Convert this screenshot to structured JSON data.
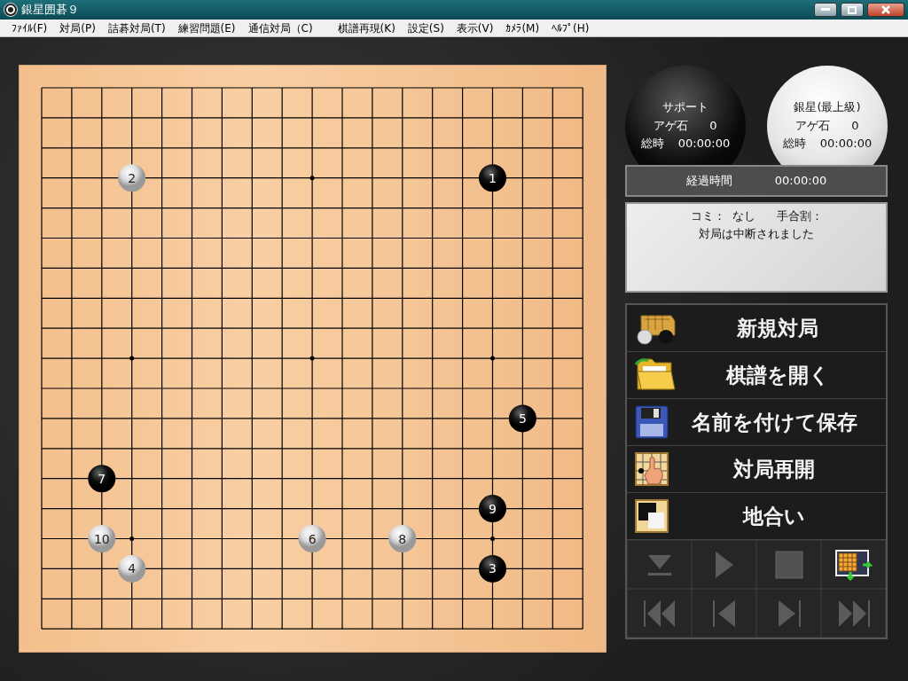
{
  "window": {
    "title": "銀星囲碁９"
  },
  "menu": [
    "ﾌｧｲﾙ(F)",
    "対局(P)",
    "詰碁対局(T)",
    "練習問題(E)",
    "通信対局（C)",
    "棋譜再現(K)",
    "設定(S)",
    "表示(V)",
    "ｶﾒﾗ(M)",
    "ﾍﾙﾌﾟ(H)"
  ],
  "board": {
    "rows": [
      [
        {
          "kind": "empty"
        },
        {
          "kind": "empty"
        },
        {
          "kind": "empty"
        },
        {
          "kind": "empty"
        },
        {
          "kind": "empty"
        },
        {
          "kind": "empty"
        },
        {
          "kind": "empty"
        },
        {
          "kind": "empty"
        },
        {
          "kind": "empty"
        },
        {
          "kind": "empty"
        },
        {
          "kind": "empty"
        },
        {
          "kind": "empty"
        },
        {
          "kind": "empty"
        },
        {
          "kind": "empty"
        },
        {
          "kind": "empty"
        },
        {
          "kind": "empty"
        },
        {
          "kind": "empty"
        },
        {
          "kind": "empty"
        },
        {
          "kind": "empty"
        }
      ],
      [
        {
          "kind": "empty"
        },
        {
          "kind": "empty"
        },
        {
          "kind": "empty"
        },
        {
          "kind": "empty"
        },
        {
          "kind": "empty"
        },
        {
          "kind": "empty"
        },
        {
          "kind": "empty"
        },
        {
          "kind": "empty"
        },
        {
          "kind": "empty"
        },
        {
          "kind": "empty"
        },
        {
          "kind": "empty"
        },
        {
          "kind": "empty"
        },
        {
          "kind": "empty"
        },
        {
          "kind": "empty"
        },
        {
          "kind": "empty"
        },
        {
          "kind": "empty"
        },
        {
          "kind": "empty"
        },
        {
          "kind": "empty"
        },
        {
          "kind": "empty"
        }
      ],
      [
        {
          "kind": "empty"
        },
        {
          "kind": "empty"
        },
        {
          "kind": "empty"
        },
        {
          "kind": "empty"
        },
        {
          "kind": "empty"
        },
        {
          "kind": "empty"
        },
        {
          "kind": "empty"
        },
        {
          "kind": "empty"
        },
        {
          "kind": "empty"
        },
        {
          "kind": "empty"
        },
        {
          "kind": "empty"
        },
        {
          "kind": "empty"
        },
        {
          "kind": "empty"
        },
        {
          "kind": "empty"
        },
        {
          "kind": "empty"
        },
        {
          "kind": "empty"
        },
        {
          "kind": "empty"
        },
        {
          "kind": "empty"
        },
        {
          "kind": "empty"
        }
      ],
      [
        {
          "kind": "empty"
        },
        {
          "kind": "empty"
        },
        {
          "kind": "empty"
        },
        {
          "kind": "white",
          "move": "2"
        },
        {
          "kind": "empty"
        },
        {
          "kind": "empty"
        },
        {
          "kind": "empty"
        },
        {
          "kind": "empty"
        },
        {
          "kind": "empty"
        },
        {
          "kind": "empty"
        },
        {
          "kind": "empty"
        },
        {
          "kind": "empty"
        },
        {
          "kind": "empty"
        },
        {
          "kind": "empty"
        },
        {
          "kind": "empty"
        },
        {
          "kind": "black",
          "move": "1"
        },
        {
          "kind": "empty"
        },
        {
          "kind": "empty"
        },
        {
          "kind": "empty"
        }
      ],
      [
        {
          "kind": "empty"
        },
        {
          "kind": "empty"
        },
        {
          "kind": "empty"
        },
        {
          "kind": "empty"
        },
        {
          "kind": "empty"
        },
        {
          "kind": "empty"
        },
        {
          "kind": "empty"
        },
        {
          "kind": "empty"
        },
        {
          "kind": "empty"
        },
        {
          "kind": "empty"
        },
        {
          "kind": "empty"
        },
        {
          "kind": "empty"
        },
        {
          "kind": "empty"
        },
        {
          "kind": "empty"
        },
        {
          "kind": "empty"
        },
        {
          "kind": "empty"
        },
        {
          "kind": "empty"
        },
        {
          "kind": "empty"
        },
        {
          "kind": "empty"
        }
      ],
      [
        {
          "kind": "empty"
        },
        {
          "kind": "empty"
        },
        {
          "kind": "empty"
        },
        {
          "kind": "empty"
        },
        {
          "kind": "empty"
        },
        {
          "kind": "empty"
        },
        {
          "kind": "empty"
        },
        {
          "kind": "empty"
        },
        {
          "kind": "empty"
        },
        {
          "kind": "empty"
        },
        {
          "kind": "empty"
        },
        {
          "kind": "empty"
        },
        {
          "kind": "empty"
        },
        {
          "kind": "empty"
        },
        {
          "kind": "empty"
        },
        {
          "kind": "empty"
        },
        {
          "kind": "empty"
        },
        {
          "kind": "empty"
        },
        {
          "kind": "empty"
        }
      ],
      [
        {
          "kind": "empty"
        },
        {
          "kind": "empty"
        },
        {
          "kind": "empty"
        },
        {
          "kind": "empty"
        },
        {
          "kind": "empty"
        },
        {
          "kind": "empty"
        },
        {
          "kind": "empty"
        },
        {
          "kind": "empty"
        },
        {
          "kind": "empty"
        },
        {
          "kind": "empty"
        },
        {
          "kind": "empty"
        },
        {
          "kind": "empty"
        },
        {
          "kind": "empty"
        },
        {
          "kind": "empty"
        },
        {
          "kind": "empty"
        },
        {
          "kind": "empty"
        },
        {
          "kind": "empty"
        },
        {
          "kind": "empty"
        },
        {
          "kind": "empty"
        }
      ],
      [
        {
          "kind": "empty"
        },
        {
          "kind": "empty"
        },
        {
          "kind": "empty"
        },
        {
          "kind": "empty"
        },
        {
          "kind": "empty"
        },
        {
          "kind": "empty"
        },
        {
          "kind": "empty"
        },
        {
          "kind": "empty"
        },
        {
          "kind": "empty"
        },
        {
          "kind": "empty"
        },
        {
          "kind": "empty"
        },
        {
          "kind": "empty"
        },
        {
          "kind": "empty"
        },
        {
          "kind": "empty"
        },
        {
          "kind": "empty"
        },
        {
          "kind": "empty"
        },
        {
          "kind": "empty"
        },
        {
          "kind": "empty"
        },
        {
          "kind": "empty"
        }
      ],
      [
        {
          "kind": "empty"
        },
        {
          "kind": "empty"
        },
        {
          "kind": "empty"
        },
        {
          "kind": "empty"
        },
        {
          "kind": "empty"
        },
        {
          "kind": "empty"
        },
        {
          "kind": "empty"
        },
        {
          "kind": "empty"
        },
        {
          "kind": "empty"
        },
        {
          "kind": "empty"
        },
        {
          "kind": "empty"
        },
        {
          "kind": "empty"
        },
        {
          "kind": "empty"
        },
        {
          "kind": "empty"
        },
        {
          "kind": "empty"
        },
        {
          "kind": "empty"
        },
        {
          "kind": "empty"
        },
        {
          "kind": "empty"
        },
        {
          "kind": "empty"
        }
      ],
      [
        {
          "kind": "empty"
        },
        {
          "kind": "empty"
        },
        {
          "kind": "empty"
        },
        {
          "kind": "empty"
        },
        {
          "kind": "empty"
        },
        {
          "kind": "empty"
        },
        {
          "kind": "empty"
        },
        {
          "kind": "empty"
        },
        {
          "kind": "empty"
        },
        {
          "kind": "empty"
        },
        {
          "kind": "empty"
        },
        {
          "kind": "empty"
        },
        {
          "kind": "empty"
        },
        {
          "kind": "empty"
        },
        {
          "kind": "empty"
        },
        {
          "kind": "empty"
        },
        {
          "kind": "empty"
        },
        {
          "kind": "empty"
        },
        {
          "kind": "empty"
        }
      ],
      [
        {
          "kind": "empty"
        },
        {
          "kind": "empty"
        },
        {
          "kind": "empty"
        },
        {
          "kind": "empty"
        },
        {
          "kind": "empty"
        },
        {
          "kind": "empty"
        },
        {
          "kind": "empty"
        },
        {
          "kind": "empty"
        },
        {
          "kind": "empty"
        },
        {
          "kind": "empty"
        },
        {
          "kind": "empty"
        },
        {
          "kind": "empty"
        },
        {
          "kind": "empty"
        },
        {
          "kind": "empty"
        },
        {
          "kind": "empty"
        },
        {
          "kind": "empty"
        },
        {
          "kind": "empty"
        },
        {
          "kind": "empty"
        },
        {
          "kind": "empty"
        }
      ],
      [
        {
          "kind": "empty"
        },
        {
          "kind": "empty"
        },
        {
          "kind": "empty"
        },
        {
          "kind": "empty"
        },
        {
          "kind": "empty"
        },
        {
          "kind": "empty"
        },
        {
          "kind": "empty"
        },
        {
          "kind": "empty"
        },
        {
          "kind": "empty"
        },
        {
          "kind": "empty"
        },
        {
          "kind": "empty"
        },
        {
          "kind": "empty"
        },
        {
          "kind": "empty"
        },
        {
          "kind": "empty"
        },
        {
          "kind": "empty"
        },
        {
          "kind": "empty"
        },
        {
          "kind": "black",
          "move": "5"
        },
        {
          "kind": "empty"
        },
        {
          "kind": "empty"
        }
      ],
      [
        {
          "kind": "empty"
        },
        {
          "kind": "empty"
        },
        {
          "kind": "empty"
        },
        {
          "kind": "empty"
        },
        {
          "kind": "empty"
        },
        {
          "kind": "empty"
        },
        {
          "kind": "empty"
        },
        {
          "kind": "empty"
        },
        {
          "kind": "empty"
        },
        {
          "kind": "empty"
        },
        {
          "kind": "empty"
        },
        {
          "kind": "empty"
        },
        {
          "kind": "empty"
        },
        {
          "kind": "empty"
        },
        {
          "kind": "empty"
        },
        {
          "kind": "empty"
        },
        {
          "kind": "empty"
        },
        {
          "kind": "empty"
        },
        {
          "kind": "empty"
        }
      ],
      [
        {
          "kind": "empty"
        },
        {
          "kind": "empty"
        },
        {
          "kind": "black",
          "move": "7"
        },
        {
          "kind": "empty"
        },
        {
          "kind": "empty"
        },
        {
          "kind": "empty"
        },
        {
          "kind": "empty"
        },
        {
          "kind": "empty"
        },
        {
          "kind": "empty"
        },
        {
          "kind": "empty"
        },
        {
          "kind": "empty"
        },
        {
          "kind": "empty"
        },
        {
          "kind": "empty"
        },
        {
          "kind": "empty"
        },
        {
          "kind": "empty"
        },
        {
          "kind": "empty"
        },
        {
          "kind": "empty"
        },
        {
          "kind": "empty"
        },
        {
          "kind": "empty"
        }
      ],
      [
        {
          "kind": "empty"
        },
        {
          "kind": "empty"
        },
        {
          "kind": "empty"
        },
        {
          "kind": "empty"
        },
        {
          "kind": "empty"
        },
        {
          "kind": "empty"
        },
        {
          "kind": "empty"
        },
        {
          "kind": "empty"
        },
        {
          "kind": "empty"
        },
        {
          "kind": "empty"
        },
        {
          "kind": "empty"
        },
        {
          "kind": "empty"
        },
        {
          "kind": "empty"
        },
        {
          "kind": "empty"
        },
        {
          "kind": "empty"
        },
        {
          "kind": "black",
          "move": "9"
        },
        {
          "kind": "empty"
        },
        {
          "kind": "empty"
        },
        {
          "kind": "empty"
        }
      ],
      [
        {
          "kind": "empty"
        },
        {
          "kind": "empty"
        },
        {
          "kind": "white",
          "move": "10"
        },
        {
          "kind": "empty"
        },
        {
          "kind": "empty"
        },
        {
          "kind": "empty"
        },
        {
          "kind": "empty"
        },
        {
          "kind": "empty"
        },
        {
          "kind": "empty"
        },
        {
          "kind": "white",
          "move": "6"
        },
        {
          "kind": "empty"
        },
        {
          "kind": "empty"
        },
        {
          "kind": "white",
          "move": "8"
        },
        {
          "kind": "empty"
        },
        {
          "kind": "empty"
        },
        {
          "kind": "empty"
        },
        {
          "kind": "empty"
        },
        {
          "kind": "empty"
        },
        {
          "kind": "empty"
        }
      ],
      [
        {
          "kind": "empty"
        },
        {
          "kind": "empty"
        },
        {
          "kind": "empty"
        },
        {
          "kind": "white",
          "move": "4"
        },
        {
          "kind": "empty"
        },
        {
          "kind": "empty"
        },
        {
          "kind": "empty"
        },
        {
          "kind": "empty"
        },
        {
          "kind": "empty"
        },
        {
          "kind": "empty"
        },
        {
          "kind": "empty"
        },
        {
          "kind": "empty"
        },
        {
          "kind": "empty"
        },
        {
          "kind": "empty"
        },
        {
          "kind": "empty"
        },
        {
          "kind": "black",
          "move": "3"
        },
        {
          "kind": "empty"
        },
        {
          "kind": "empty"
        },
        {
          "kind": "empty"
        }
      ],
      [
        {
          "kind": "empty"
        },
        {
          "kind": "empty"
        },
        {
          "kind": "empty"
        },
        {
          "kind": "empty"
        },
        {
          "kind": "empty"
        },
        {
          "kind": "empty"
        },
        {
          "kind": "empty"
        },
        {
          "kind": "empty"
        },
        {
          "kind": "empty"
        },
        {
          "kind": "empty"
        },
        {
          "kind": "empty"
        },
        {
          "kind": "empty"
        },
        {
          "kind": "empty"
        },
        {
          "kind": "empty"
        },
        {
          "kind": "empty"
        },
        {
          "kind": "empty"
        },
        {
          "kind": "empty"
        },
        {
          "kind": "empty"
        },
        {
          "kind": "empty"
        }
      ],
      [
        {
          "kind": "empty"
        },
        {
          "kind": "empty"
        },
        {
          "kind": "empty"
        },
        {
          "kind": "empty"
        },
        {
          "kind": "empty"
        },
        {
          "kind": "empty"
        },
        {
          "kind": "empty"
        },
        {
          "kind": "empty"
        },
        {
          "kind": "empty"
        },
        {
          "kind": "empty"
        },
        {
          "kind": "empty"
        },
        {
          "kind": "empty"
        },
        {
          "kind": "empty"
        },
        {
          "kind": "empty"
        },
        {
          "kind": "empty"
        },
        {
          "kind": "empty"
        },
        {
          "kind": "empty"
        },
        {
          "kind": "empty"
        },
        {
          "kind": "empty"
        }
      ]
    ]
  },
  "players": [
    {
      "kind": "black",
      "name": "サポート",
      "captures_label": "アゲ石",
      "captures": "0",
      "time_label": "総時",
      "time": "00:00:00"
    },
    {
      "kind": "white",
      "name": "銀星(最上級)",
      "captures_label": "アゲ石",
      "captures": "0",
      "time_label": "総時",
      "time": "00:00:00"
    }
  ],
  "elapsed": {
    "label": "経過時間",
    "time": "00:00:00"
  },
  "info": {
    "komi_label": "コミ：",
    "komi": "なし",
    "handicap_label": "手合割：",
    "message": "対局は中断されました"
  },
  "actions": [
    {
      "kind": "new",
      "label": "新規対局"
    },
    {
      "kind": "open",
      "label": "棋譜を開く"
    },
    {
      "kind": "save",
      "label": "名前を付けて保存"
    },
    {
      "kind": "resume",
      "label": "対局再開"
    },
    {
      "kind": "count",
      "label": "地合い"
    }
  ],
  "controls": [
    {
      "kind": "down",
      "disabled": true
    },
    {
      "kind": "play",
      "disabled": true
    },
    {
      "kind": "stop",
      "disabled": true
    },
    {
      "kind": "export",
      "disabled": false
    },
    {
      "kind": "first",
      "disabled": true
    },
    {
      "kind": "back",
      "disabled": true
    },
    {
      "kind": "forward",
      "disabled": true
    },
    {
      "kind": "last",
      "disabled": true
    }
  ]
}
